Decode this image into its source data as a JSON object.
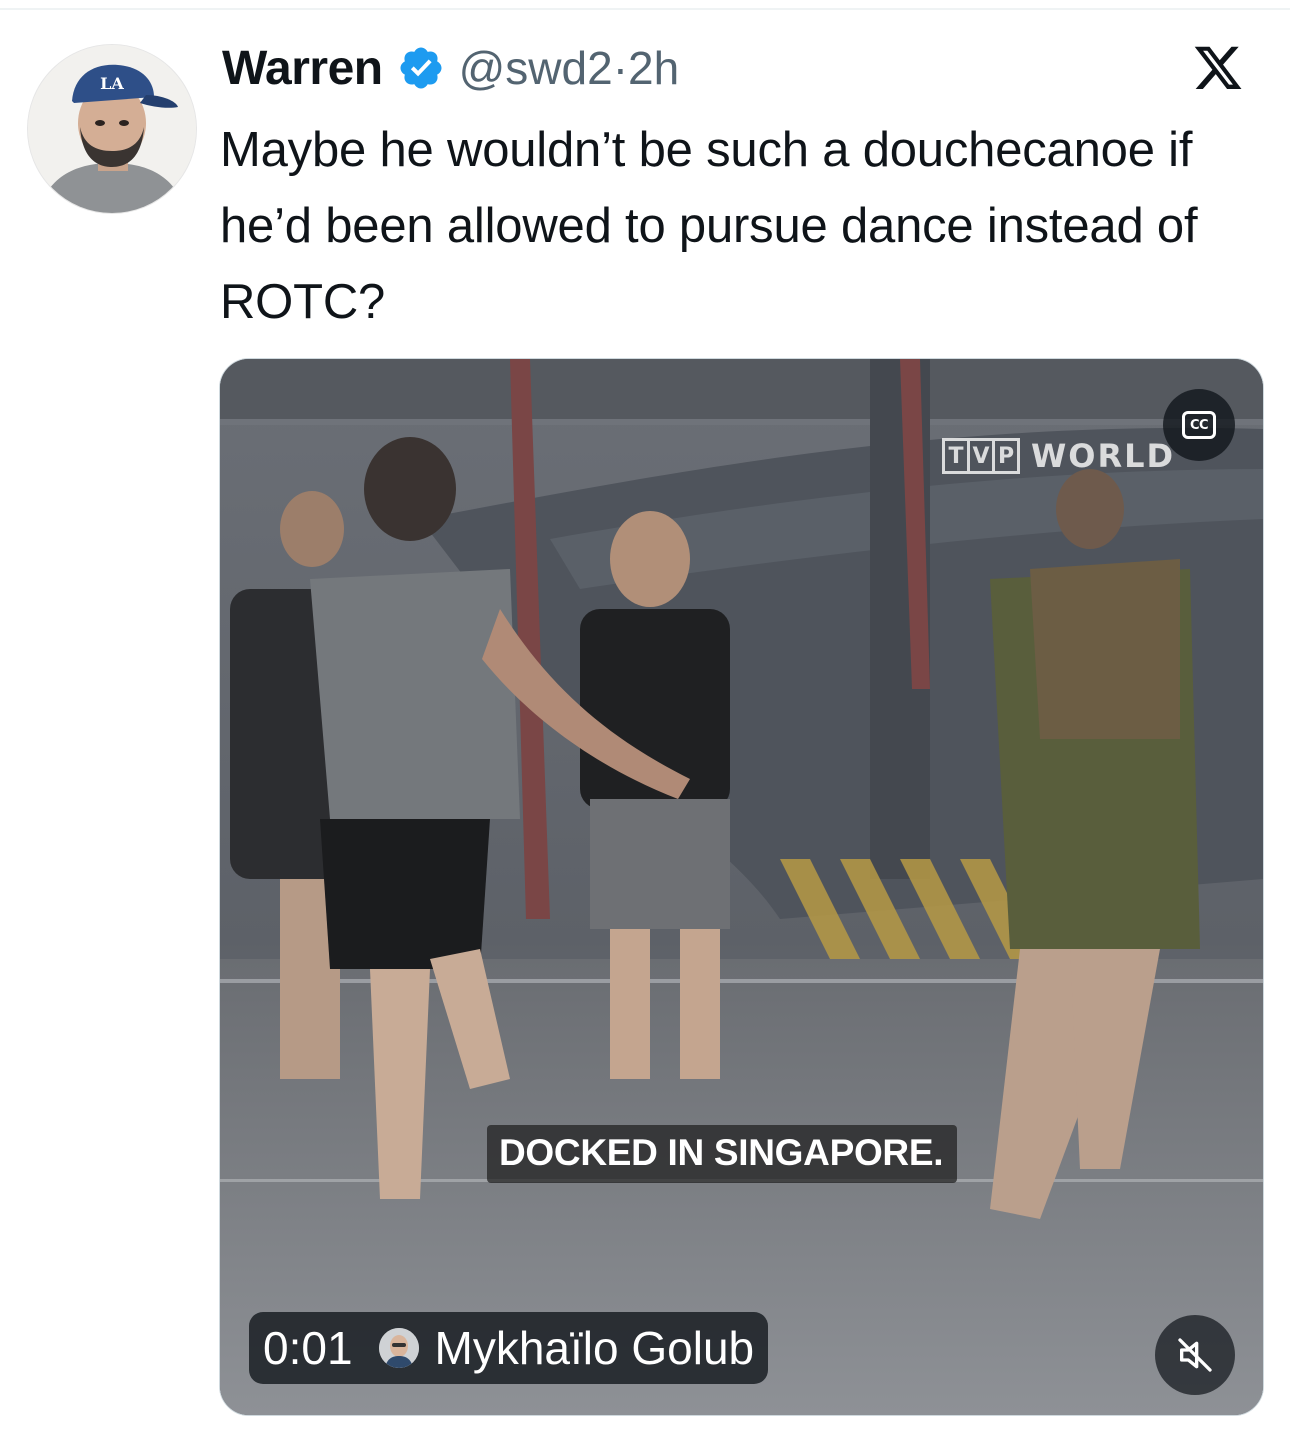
{
  "tweet": {
    "display_name": "Warren",
    "verified": true,
    "handle": "@swd2",
    "separator": "·",
    "time": "2h",
    "text": "Maybe he wouldn’t be such a douchecanoe if he’d been allowed to pursue dance instead of ROTC?"
  },
  "header": {
    "brand_icon": "x-logo-icon"
  },
  "video": {
    "cc_label": "CC",
    "watermark_box": [
      "T",
      "V",
      "P"
    ],
    "watermark_word": "WORLD",
    "caption": "DOCKED IN SINGAPORE.",
    "timestamp": "0:01",
    "uploader_name": "Mykhaïlo Golub",
    "muted": true
  },
  "colors": {
    "text": "#0f1419",
    "secondary": "#536471",
    "verified": "#1d9bf0",
    "overlay": "#0f1419"
  }
}
